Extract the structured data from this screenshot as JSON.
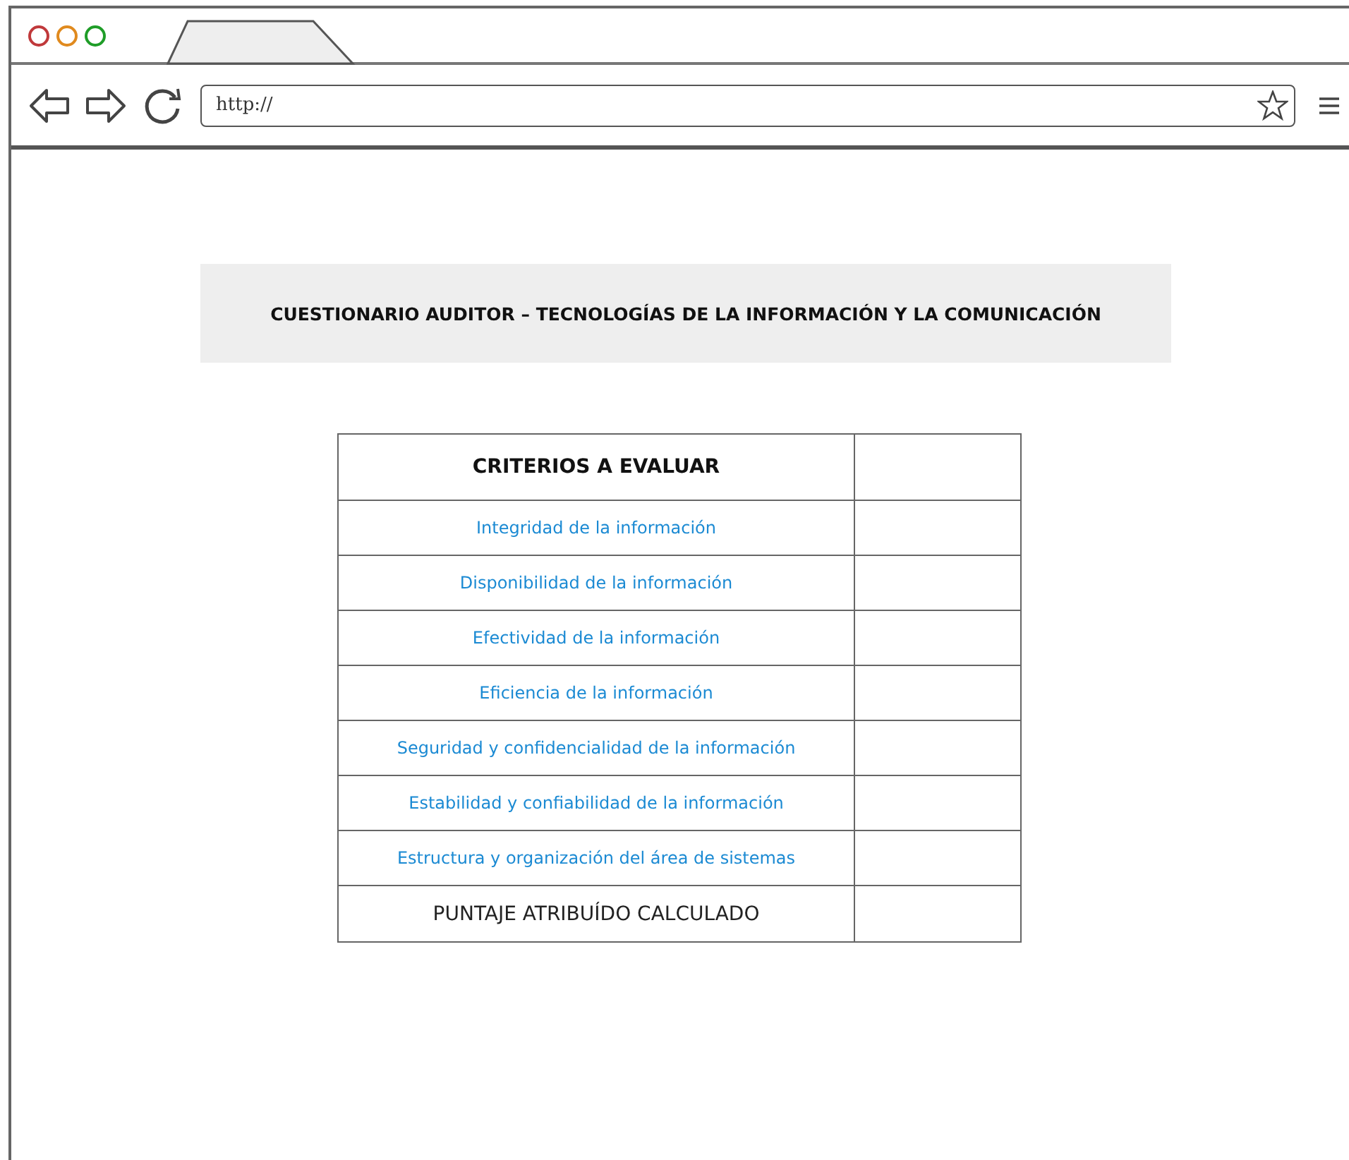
{
  "browser": {
    "url": "http://"
  },
  "banner": {
    "title": "CUESTIONARIO AUDITOR – TECNOLOGÍAS DE LA INFORMACIÓN Y LA COMUNICACIÓN"
  },
  "table": {
    "rows": [
      {
        "kind": "header",
        "label": "CRITERIOS A EVALUAR"
      },
      {
        "kind": "link",
        "label": "Integridad de la información"
      },
      {
        "kind": "link",
        "label": "Disponibilidad de la información"
      },
      {
        "kind": "link",
        "label": "Efectividad de la información"
      },
      {
        "kind": "link",
        "label": "Eficiencia de la información"
      },
      {
        "kind": "link",
        "label": "Seguridad y confidencialidad de la información"
      },
      {
        "kind": "link",
        "label": "Estabilidad y confiabilidad de la información"
      },
      {
        "kind": "link",
        "label": "Estructura y organización del área de sistemas"
      },
      {
        "kind": "total",
        "label": "PUNTAJE ATRIBUÍDO CALCULADO"
      }
    ]
  }
}
